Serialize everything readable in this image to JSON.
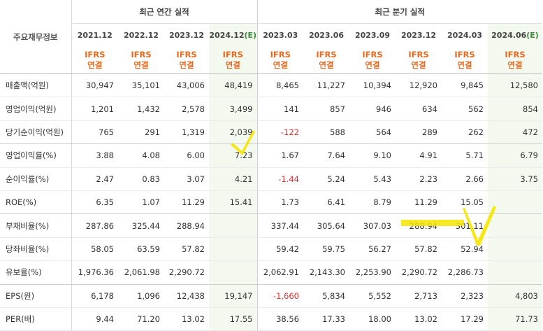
{
  "header": {
    "row_title": "주요재무정보",
    "annual_group": "최근 연간 실적",
    "quarter_group": "최근 분기 실적",
    "annual_periods": [
      {
        "period": "2021.12",
        "est": ""
      },
      {
        "period": "2022.12",
        "est": ""
      },
      {
        "period": "2023.12",
        "est": ""
      },
      {
        "period": "2024.12",
        "est": "(E)"
      }
    ],
    "quarter_periods": [
      {
        "period": "2023.03",
        "est": ""
      },
      {
        "period": "2023.06",
        "est": ""
      },
      {
        "period": "2023.09",
        "est": ""
      },
      {
        "period": "2023.12",
        "est": ""
      },
      {
        "period": "2024.03",
        "est": ""
      },
      {
        "period": "2024.06",
        "est": "(E)"
      }
    ],
    "ifrs_line1": "IFRS",
    "ifrs_line2": "연결"
  },
  "rows": [
    {
      "label": "매출액(억원)",
      "values": [
        "30,947",
        "35,101",
        "43,006",
        "48,419",
        "8,465",
        "11,227",
        "10,394",
        "12,920",
        "9,845",
        "12,580"
      ]
    },
    {
      "label": "영업이익(억원)",
      "values": [
        "1,201",
        "1,432",
        "2,578",
        "3,499",
        "141",
        "857",
        "946",
        "634",
        "562",
        "854"
      ]
    },
    {
      "label": "당기순이익(억원)",
      "values": [
        "765",
        "291",
        "1,319",
        "2,039",
        "-122",
        "588",
        "564",
        "289",
        "262",
        "472"
      ]
    },
    {
      "label": "영업이익률(%)",
      "values": [
        "3.88",
        "4.08",
        "6.00",
        "7.23",
        "1.67",
        "7.64",
        "9.10",
        "4.91",
        "5.71",
        "6.79"
      ]
    },
    {
      "label": "순이익률(%)",
      "values": [
        "2.47",
        "0.83",
        "3.07",
        "4.21",
        "-1.44",
        "5.24",
        "5.43",
        "2.23",
        "2.66",
        "3.75"
      ]
    },
    {
      "label": "ROE(%)",
      "values": [
        "6.35",
        "1.07",
        "11.29",
        "15.41",
        "1.73",
        "6.41",
        "8.79",
        "11.29",
        "15.05",
        ""
      ]
    },
    {
      "label": "부채비율(%)",
      "values": [
        "287.86",
        "325.44",
        "288.94",
        "",
        "337.44",
        "305.64",
        "307.03",
        "288.94",
        "301.11",
        ""
      ]
    },
    {
      "label": "당좌비율(%)",
      "values": [
        "58.05",
        "63.59",
        "57.82",
        "",
        "59.42",
        "59.75",
        "56.27",
        "57.82",
        "52.94",
        ""
      ]
    },
    {
      "label": "유보율(%)",
      "values": [
        "1,976.36",
        "2,061.98",
        "2,290.72",
        "",
        "2,062.91",
        "2,143.30",
        "2,253.90",
        "2,290.72",
        "2,286.73",
        ""
      ]
    },
    {
      "label": "EPS(원)",
      "values": [
        "6,178",
        "1,096",
        "12,438",
        "19,147",
        "-1,660",
        "5,834",
        "5,552",
        "2,713",
        "2,323",
        "4,803"
      ]
    },
    {
      "label": "PER(배)",
      "values": [
        "9.44",
        "71.20",
        "13.02",
        "17.55",
        "38.56",
        "17.33",
        "18.00",
        "13.02",
        "17.29",
        "71.73"
      ]
    }
  ],
  "colors": {
    "ifrs": "#e9691f",
    "negative": "#e03030",
    "estimate_bg": "#f3f9ee",
    "highlight": "#f5e400"
  }
}
